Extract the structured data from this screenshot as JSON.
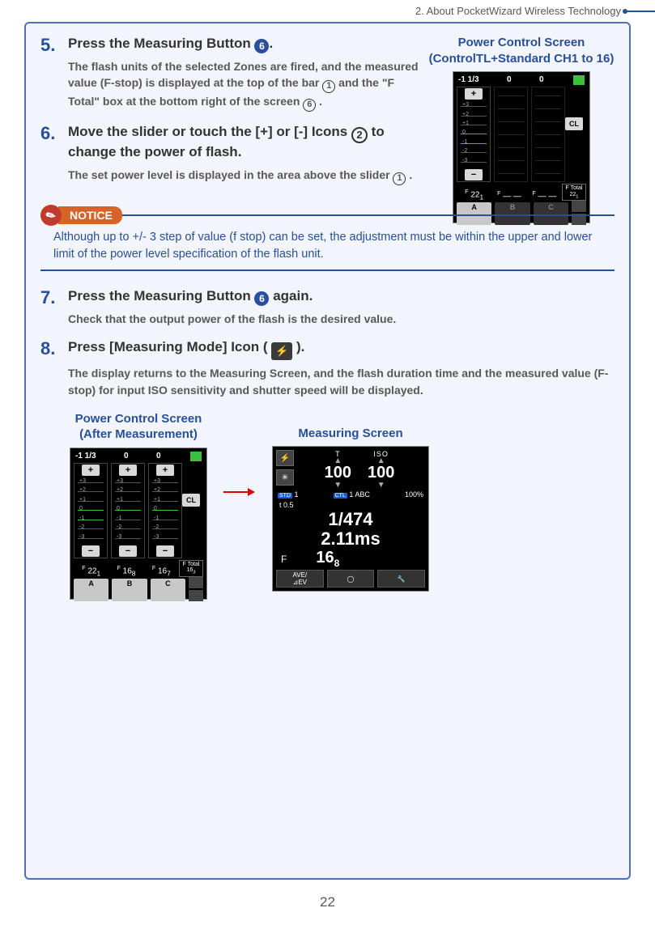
{
  "header": {
    "section": "2.  About PocketWizard Wireless Technology"
  },
  "steps": {
    "s5": {
      "num": "5.",
      "title_a": "Press the Measuring Button ",
      "title_badge": "6",
      "title_b": ".",
      "desc_a": "The flash units of the selected Zones are fired, and the measured value (F-stop) is displayed at the top of the bar ",
      "desc_c1": "1",
      "desc_b": " and the \"F Total\" box at the bottom right of the screen ",
      "desc_c2": "6",
      "desc_c": " ."
    },
    "s6": {
      "num": "6.",
      "title_a": "Move the slider or touch the [+] or [-] Icons ",
      "title_circ": "2",
      "title_b": " to change the power of flash.",
      "desc_a": "The set power level is displayed in the area above the slider ",
      "desc_c1": "1",
      "desc_b": " ."
    },
    "s7": {
      "num": "7.",
      "title_a": "Press the Measuring Button ",
      "title_badge": "6",
      "title_b": " again.",
      "desc": "Check that the output power of the flash is the desired value."
    },
    "s8": {
      "num": "8.",
      "title_a": "Press  [Measuring Mode] Icon ( ",
      "title_b": " ).",
      "desc": "The display returns to the Measuring Screen, and the flash duration time and the measured value (F-stop) for input ISO sensitivity and shutter speed will be displayed."
    }
  },
  "notice": {
    "label": "NOTICE",
    "text": "Although up to +/- 3 step of value (f stop) can be set, the adjustment must be within the upper and lower limit of the power level specification of the flash unit."
  },
  "figures": {
    "top": {
      "caption_l1": "Power Control Screen",
      "caption_l2": "(ControlTL+Standard CH1 to 16)"
    },
    "after": {
      "caption_l1": "Power Control Screen",
      "caption_l2": "(After Measurement)"
    },
    "measuring": {
      "caption": "Measuring Screen"
    }
  },
  "power_screen_1": {
    "top_labels": [
      "-1 1/3",
      "0",
      "0"
    ],
    "plus": "+",
    "minus": "−",
    "cl": "CL",
    "ticks": [
      "+3",
      "+2",
      "+1",
      "0",
      "-1",
      "-2",
      "-3"
    ],
    "fvals": [
      "22",
      "— —",
      "— —"
    ],
    "fvals_sub": [
      "1",
      "",
      ""
    ],
    "ftotal_label": "F Total",
    "ftotal_value": "22",
    "ftotal_sub": "1",
    "abc": [
      "A",
      "B",
      "C"
    ]
  },
  "power_screen_2": {
    "top_labels": [
      "-1 1/3",
      "0",
      "0"
    ],
    "plus": "+",
    "minus": "−",
    "cl": "CL",
    "ticks": [
      "+3",
      "+2",
      "+1",
      "0",
      "-1",
      "-2",
      "-3"
    ],
    "fvals": [
      "22",
      "16",
      "16"
    ],
    "fvals_sub": [
      "1",
      "8",
      "7"
    ],
    "ftotal_label": "F Total",
    "ftotal_value": "16",
    "ftotal_sub": "3",
    "abc": [
      "A",
      "B",
      "C"
    ]
  },
  "measuring_screen": {
    "t_label": "T",
    "iso_label": "ISO",
    "t_value": "100",
    "iso_value": "100",
    "std": "STD",
    "ctl": "CTL",
    "one": "1",
    "t05": "t 0.5",
    "one_abc": "1  ABC",
    "pct": "100%",
    "line1": "1/474",
    "line2": "2.11ms",
    "f_label": "F",
    "f_value": "16",
    "f_sub": "8",
    "bot1": "AVE/",
    "bot1b": "⊿EV"
  },
  "page_number": "22"
}
